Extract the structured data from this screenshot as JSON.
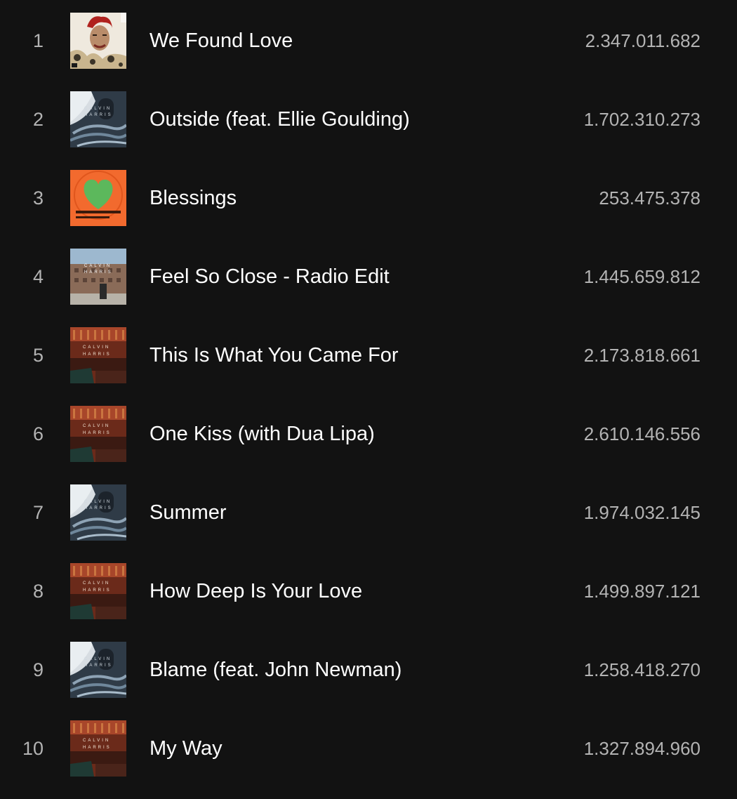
{
  "tracks": [
    {
      "number": "1",
      "title": "We Found Love",
      "plays": "2.347.011.682",
      "artwork": "talk-that-talk-artwork"
    },
    {
      "number": "2",
      "title": "Outside (feat. Ellie Goulding)",
      "plays": "1.702.310.273",
      "artwork": "motion-artwork"
    },
    {
      "number": "3",
      "title": "Blessings",
      "plays": "253.475.378",
      "artwork": "blessings-artwork"
    },
    {
      "number": "4",
      "title": "Feel So Close - Radio Edit",
      "plays": "1.445.659.812",
      "artwork": "18-months-artwork"
    },
    {
      "number": "5",
      "title": "This Is What You Came For",
      "plays": "2.173.818.661",
      "artwork": "calvin-harris-red-artwork"
    },
    {
      "number": "6",
      "title": "One Kiss (with Dua Lipa)",
      "plays": "2.610.146.556",
      "artwork": "calvin-harris-red-artwork"
    },
    {
      "number": "7",
      "title": "Summer",
      "plays": "1.974.032.145",
      "artwork": "motion-artwork"
    },
    {
      "number": "8",
      "title": "How Deep Is Your Love",
      "plays": "1.499.897.121",
      "artwork": "calvin-harris-red-artwork"
    },
    {
      "number": "9",
      "title": "Blame (feat. John Newman)",
      "plays": "1.258.418.270",
      "artwork": "motion-artwork"
    },
    {
      "number": "10",
      "title": "My Way",
      "plays": "1.327.894.960",
      "artwork": "calvin-harris-red-artwork"
    }
  ],
  "artwork_text": {
    "calvin": "CALVIN",
    "harris": "HARRIS"
  },
  "colors": {
    "background": "#121212",
    "title": "#ffffff",
    "secondary": "#b3b3b3",
    "blessings_orange": "#f26a2e",
    "blessings_heart": "#5cb85c"
  }
}
